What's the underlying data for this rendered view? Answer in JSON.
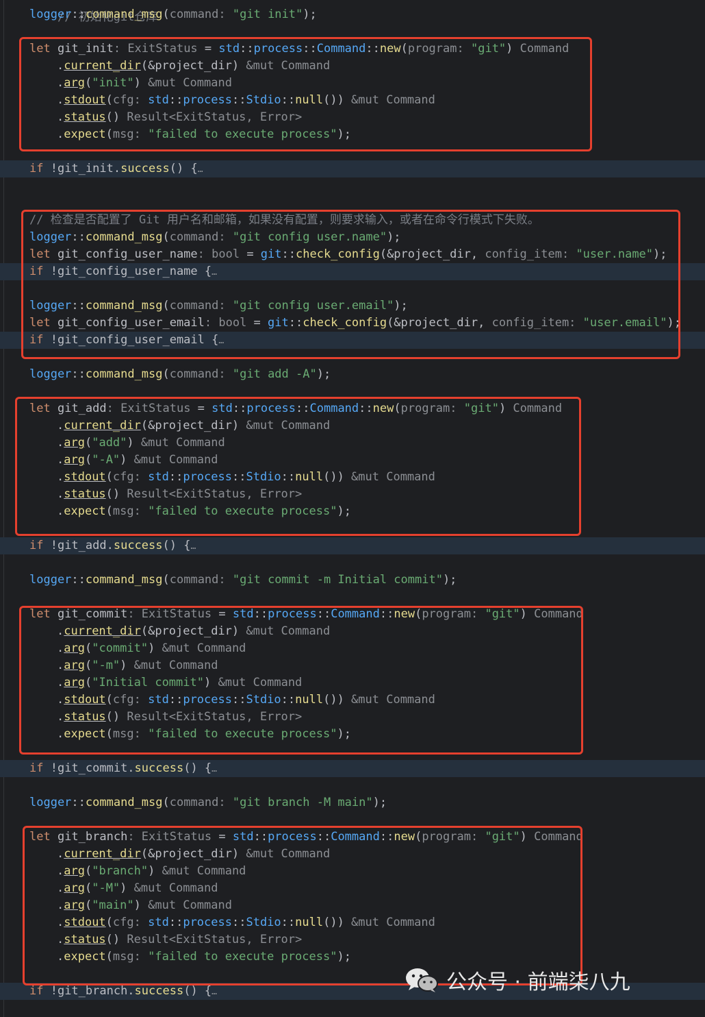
{
  "editor": {
    "top_partial_comment": "// 初始化git仓库",
    "lines": [
      {
        "text": "logger::command_msg(command: \"git init\");"
      },
      {
        "text": ""
      },
      {
        "text": "let git_init: ExitStatus = std::process::Command::new(program: \"git\") Command"
      },
      {
        "text": ".current_dir(&project_dir) &mut Command"
      },
      {
        "text": ".arg(\"init\") &mut Command"
      },
      {
        "text": ".stdout(cfg: std::process::Stdio::null()) &mut Command"
      },
      {
        "text": ".status() Result<ExitStatus, Error>"
      },
      {
        "text": ".expect(msg: \"failed to execute process\");"
      },
      {
        "text": ""
      },
      {
        "text": "if !git_init.success() {…"
      },
      {
        "text": ""
      },
      {
        "text": ""
      },
      {
        "text": "// 检查是否配置了 Git 用户名和邮箱，如果没有配置，则要求输入，或者在命令行模式下失败。"
      },
      {
        "text": "logger::command_msg(command: \"git config user.name\");"
      },
      {
        "text": "let git_config_user_name: bool = git::check_config(&project_dir, config_item: \"user.name\");"
      },
      {
        "text": "if !git_config_user_name {…"
      },
      {
        "text": ""
      },
      {
        "text": "logger::command_msg(command: \"git config user.email\");"
      },
      {
        "text": "let git_config_user_email: bool = git::check_config(&project_dir, config_item: \"user.email\");"
      },
      {
        "text": "if !git_config_user_email {…"
      },
      {
        "text": ""
      },
      {
        "text": "logger::command_msg(command: \"git add -A\");"
      },
      {
        "text": ""
      },
      {
        "text": "let git_add: ExitStatus = std::process::Command::new(program: \"git\") Command"
      },
      {
        "text": ".current_dir(&project_dir) &mut Command"
      },
      {
        "text": ".arg(\"add\") &mut Command"
      },
      {
        "text": ".arg(\"-A\") &mut Command"
      },
      {
        "text": ".stdout(cfg: std::process::Stdio::null()) &mut Command"
      },
      {
        "text": ".status() Result<ExitStatus, Error>"
      },
      {
        "text": ".expect(msg: \"failed to execute process\");"
      },
      {
        "text": ""
      },
      {
        "text": "if !git_add.success() {…"
      },
      {
        "text": ""
      },
      {
        "text": "logger::command_msg(command: \"git commit -m Initial commit\");"
      },
      {
        "text": ""
      },
      {
        "text": "let git_commit: ExitStatus = std::process::Command::new(program: \"git\") Command"
      },
      {
        "text": ".current_dir(&project_dir) &mut Command"
      },
      {
        "text": ".arg(\"commit\") &mut Command"
      },
      {
        "text": ".arg(\"-m\") &mut Command"
      },
      {
        "text": ".arg(\"Initial commit\") &mut Command"
      },
      {
        "text": ".stdout(cfg: std::process::Stdio::null()) &mut Command"
      },
      {
        "text": ".status() Result<ExitStatus, Error>"
      },
      {
        "text": ".expect(msg: \"failed to execute process\");"
      },
      {
        "text": ""
      },
      {
        "text": "if !git_commit.success() {…"
      },
      {
        "text": ""
      },
      {
        "text": "logger::command_msg(command: \"git branch -M main\");"
      },
      {
        "text": ""
      },
      {
        "text": "let git_branch: ExitStatus = std::process::Command::new(program: \"git\") Command"
      },
      {
        "text": ".current_dir(&project_dir) &mut Command"
      },
      {
        "text": ".arg(\"branch\") &mut Command"
      },
      {
        "text": ".arg(\"-M\") &mut Command"
      },
      {
        "text": ".arg(\"main\") &mut Command"
      },
      {
        "text": ".stdout(cfg: std::process::Stdio::null()) &mut Command"
      },
      {
        "text": ".status() Result<ExitStatus, Error>"
      },
      {
        "text": ".expect(msg: \"failed to execute process\");"
      },
      {
        "text": ""
      },
      {
        "text": "if !git_branch.success() {…"
      }
    ]
  },
  "watermark": {
    "text": "公众号 · 前端柒八九",
    "icon": "wechat-icon"
  },
  "colors": {
    "background": "#1e1f22",
    "highlight": "#25303d",
    "annotation_box": "#e5402e",
    "keyword": "#cf8e6d",
    "string": "#6aab73",
    "function": "#e6db8f",
    "hint": "#8c8f94",
    "path": "#56a8f5"
  }
}
